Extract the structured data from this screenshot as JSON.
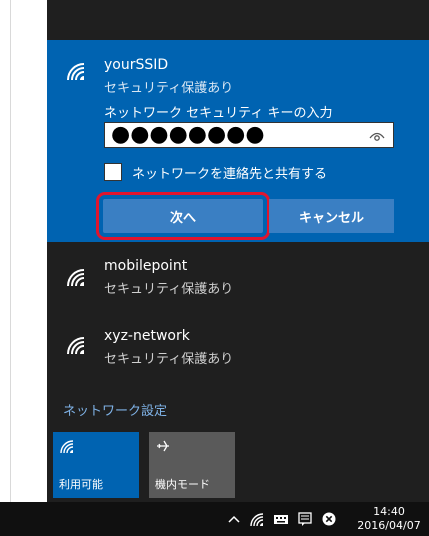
{
  "networks": {
    "selected": {
      "ssid": "yourSSID",
      "security": "セキュリティ保護あり",
      "key_label": "ネットワーク セキュリティ キーの入力",
      "password_mask": "●●●●●●●●",
      "share_label": "ネットワークを連絡先と共有する",
      "next_button": "次へ",
      "cancel_button": "キャンセル"
    },
    "others": [
      {
        "ssid": "mobilepoint",
        "security": "セキュリティ保護あり"
      },
      {
        "ssid": "xyz-network",
        "security": "セキュリティ保護あり"
      }
    ]
  },
  "settings_link": "ネットワーク設定",
  "quick_actions": [
    {
      "label": "利用可能",
      "icon": "wifi-icon",
      "active": true
    },
    {
      "label": "機内モード",
      "icon": "airplane-icon",
      "active": false
    }
  ],
  "taskbar": {
    "time": "14:40",
    "date": "2016/04/07",
    "icons": [
      "chevron-up-icon",
      "wifi-icon",
      "keyboard-icon",
      "action-center-icon",
      "close-circle-icon"
    ]
  },
  "colors": {
    "accent": "#0063b1",
    "highlight": "#e0152e",
    "flyout_bg": "#1f1f1f",
    "button": "#3a7fc3"
  }
}
